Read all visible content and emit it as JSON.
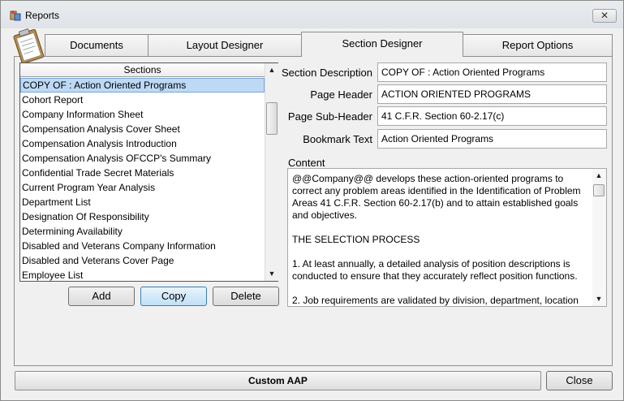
{
  "window": {
    "title": "Reports",
    "close_glyph": "✕"
  },
  "tabs": [
    {
      "label": "Documents"
    },
    {
      "label": "Layout Designer"
    },
    {
      "label": "Section Designer"
    },
    {
      "label": "Report Options"
    }
  ],
  "active_tab": "Section Designer",
  "sections": {
    "header": "Sections",
    "selected_index": 0,
    "items": [
      "COPY OF : Action Oriented Programs",
      "Cohort Report",
      "Company Information Sheet",
      "Compensation Analysis Cover Sheet",
      "Compensation Analysis Introduction",
      "Compensation Analysis OFCCP's Summary",
      "Confidential Trade Secret Materials",
      "Current Program Year Analysis",
      "Department List",
      "Designation Of Responsibility",
      "Determining Availability",
      "Disabled and Veterans Company Information",
      "Disabled and Veterans Cover Page",
      "Employee List"
    ]
  },
  "buttons": {
    "add": "Add",
    "copy": "Copy",
    "delete": "Delete",
    "close": "Close"
  },
  "form": {
    "section_description_label": "Section Description",
    "section_description_value": "COPY OF : Action Oriented Programs",
    "page_header_label": "Page Header",
    "page_header_value": "ACTION ORIENTED PROGRAMS",
    "page_subheader_label": "Page Sub-Header",
    "page_subheader_value": "41 C.F.R. Section 60-2.17(c)",
    "bookmark_label": "Bookmark Text",
    "bookmark_value": "Action Oriented Programs",
    "content_label": "Content",
    "content_paragraphs": [
      "@@Company@@ develops these action-oriented programs to correct any problem areas identified in the Identification of Problem Areas 41 C.F.R. Section 60-2.17(b) and to attain established goals and objectives.",
      "THE SELECTION PROCESS",
      "1.  At least annually, a detailed analysis of position descriptions is conducted to ensure that they accurately reflect position functions.",
      "2.  Job requirements are validated by division, department, location"
    ]
  },
  "footer": {
    "title": "Custom AAP"
  },
  "icons": {
    "app": "reports-app-icon",
    "clipboard": "clipboard-icon",
    "scroll_up": "▲",
    "scroll_down": "▼"
  }
}
